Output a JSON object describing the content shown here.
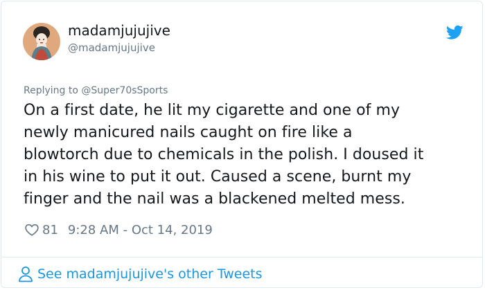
{
  "author": {
    "display_name": "madamjujujive",
    "handle": "@madamjujujive",
    "avatar_icon": "avatar-portrait"
  },
  "reply": {
    "prefix": "Replying to",
    "mention": "@Super70sSports"
  },
  "tweet": {
    "lines": [
      "On a first date, he lit my cigarette and one of my",
      "newly manicured nails caught on fire like a",
      "blowtorch due to chemicals in the polish. I doused it",
      "in his wine to put it out. Caused a scene, burnt my",
      "finger and the nail was a blackened melted mess."
    ]
  },
  "meta": {
    "like_count": "81",
    "timestamp": "9:28 AM - Oct 14, 2019"
  },
  "footer": {
    "link_text": "See madamjujujive's other Tweets"
  },
  "colors": {
    "brand_blue": "#1da1f2",
    "link_blue": "#1b95e0",
    "text_primary": "#14171a",
    "text_secondary": "#657786",
    "border": "#e1e8ed"
  },
  "icons": {
    "brand": "twitter-bird-icon",
    "like": "heart-outline-icon",
    "profile": "person-outline-icon"
  }
}
